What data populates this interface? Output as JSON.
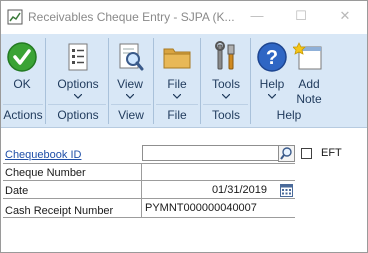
{
  "window": {
    "title": "Receivables Cheque Entry  -  SJPA (K...",
    "controls": {
      "minimize": "—",
      "maximize": "☐",
      "close": "✕"
    }
  },
  "ribbon": {
    "buttons": [
      {
        "id": "ok",
        "label": "OK",
        "icon": "green-check-icon"
      },
      {
        "id": "options",
        "label": "Options",
        "icon": "list-options-icon"
      },
      {
        "id": "view",
        "label": "View",
        "icon": "magnifier-document-icon"
      },
      {
        "id": "file",
        "label": "File",
        "icon": "folder-icon"
      },
      {
        "id": "tools",
        "label": "Tools",
        "icon": "tools-icon"
      },
      {
        "id": "help",
        "label": "Help",
        "icon": "help-question-icon"
      },
      {
        "id": "add_note",
        "label_line1": "Add",
        "label_line2": "Note",
        "icon": "add-note-icon"
      }
    ],
    "groups": [
      "Actions",
      "Options",
      "View",
      "File",
      "Tools",
      "Help"
    ]
  },
  "form": {
    "chequebook_id": {
      "label": "Chequebook ID",
      "value": ""
    },
    "eft": {
      "label": "EFT",
      "checked": false
    },
    "cheque_number": {
      "label": "Cheque Number",
      "value": ""
    },
    "date": {
      "label": "Date",
      "value": "01/31/2019"
    },
    "cash_receipt_number": {
      "label": "Cash Receipt Number",
      "value": "PYMNT000000040007"
    }
  },
  "colors": {
    "ribbon_bg": "#d8e7f6",
    "ribbon_text": "#1f3a5c",
    "link": "#1f4fa8",
    "ok_green": "#3aa335",
    "help_blue": "#2f66c4"
  }
}
